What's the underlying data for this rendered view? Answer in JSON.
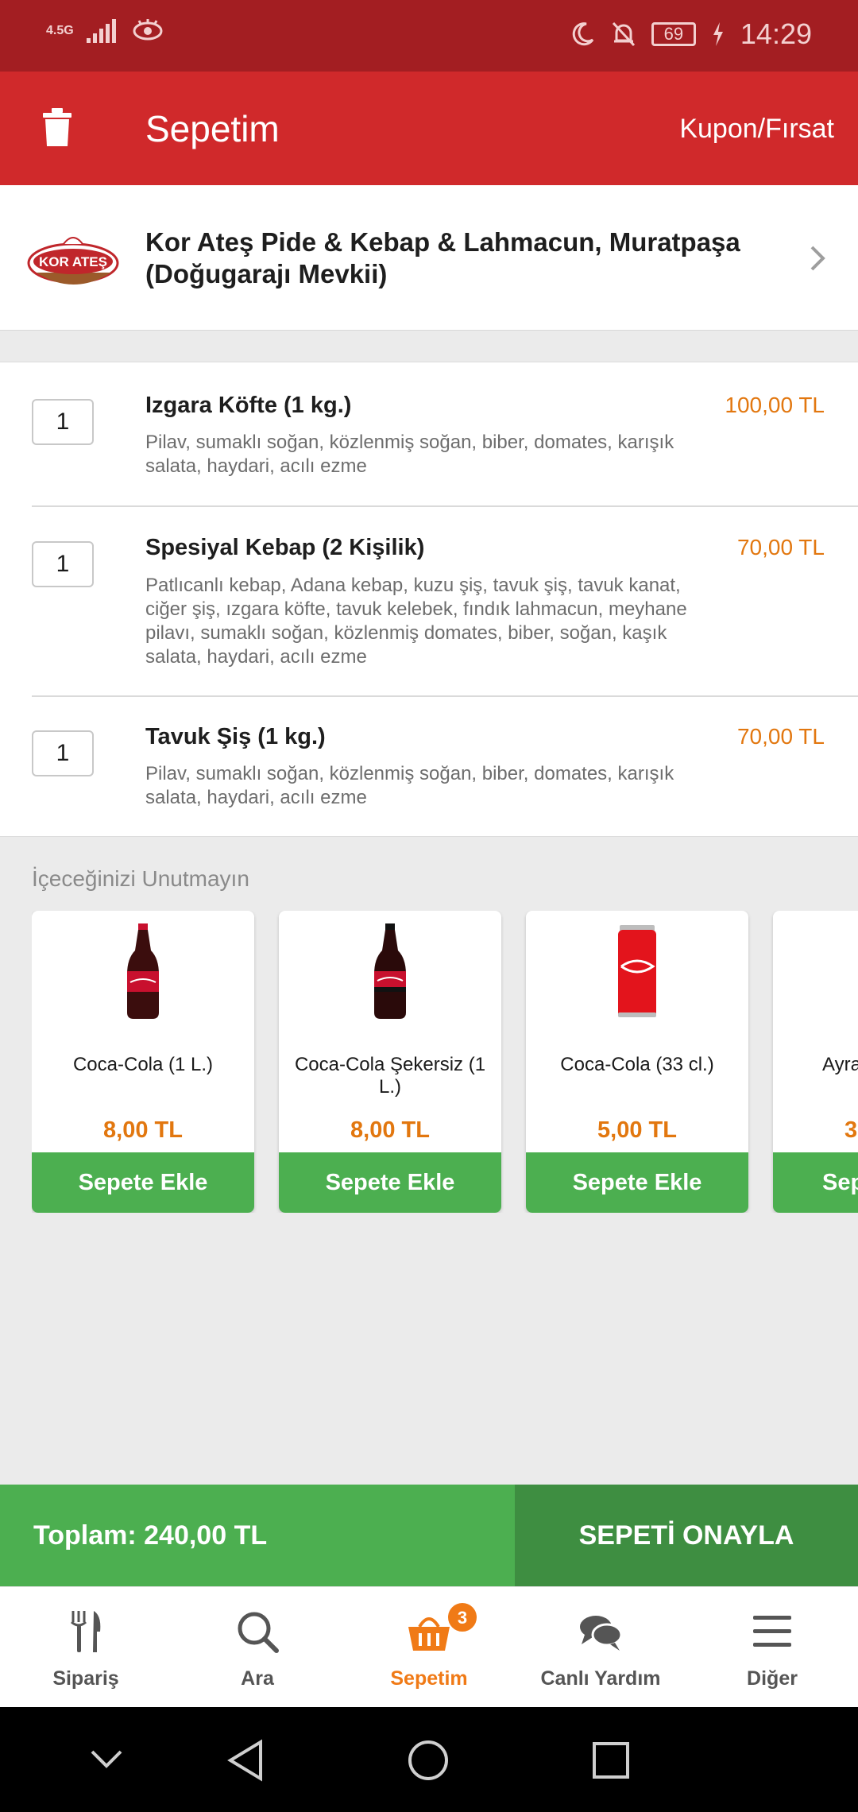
{
  "status_bar": {
    "network": "4.5G",
    "battery": "69",
    "time": "14:29"
  },
  "toolbar": {
    "title": "Sepetim",
    "coupon_label": "Kupon/Fırsat"
  },
  "restaurant": {
    "name": "Kor Ateş Pide & Kebap & Lahmacun, Muratpaşa (Doğugarajı Mevkii)",
    "logo_text": "KOR ATEŞ"
  },
  "cart_items": [
    {
      "qty": "1",
      "name": "Izgara Köfte (1 kg.)",
      "price": "100,00 TL",
      "desc": "Pilav, sumaklı soğan, közlenmiş soğan, biber, domates, karışık salata, haydari, acılı ezme"
    },
    {
      "qty": "1",
      "name": "Spesiyal Kebap (2 Kişilik)",
      "price": "70,00 TL",
      "desc": "Patlıcanlı kebap, Adana kebap, kuzu şiş, tavuk şiş, tavuk kanat, ciğer şiş, ızgara köfte, tavuk kelebek, fındık lahmacun, meyhane pilavı, sumaklı soğan, közlenmiş domates, biber, soğan, kaşık salata, haydari, acılı ezme"
    },
    {
      "qty": "1",
      "name": "Tavuk Şiş (1 kg.)",
      "price": "70,00 TL",
      "desc": "Pilav, sumaklı soğan, közlenmiş soğan, biber, domates, karışık salata, haydari, acılı ezme"
    }
  ],
  "drinks": {
    "title": "İçeceğinizi Unutmayın",
    "add_label": "Sepete Ekle",
    "items": [
      {
        "name": "Coca-Cola (1 L.)",
        "price": "8,00 TL"
      },
      {
        "name": "Coca-Cola Şekersiz (1 L.)",
        "price": "8,00 TL"
      },
      {
        "name": "Coca-Cola (33 cl.)",
        "price": "5,00 TL"
      },
      {
        "name": "Ayra",
        "price": "3"
      }
    ]
  },
  "total": {
    "label": "Toplam: 240,00 TL",
    "confirm_label": "SEPETİ ONAYLA"
  },
  "tabs": [
    {
      "label": "Sipariş",
      "icon": "fork-knife-icon"
    },
    {
      "label": "Ara",
      "icon": "search-icon"
    },
    {
      "label": "Sepetim",
      "icon": "basket-icon",
      "badge": "3",
      "active": true
    },
    {
      "label": "Canlı Yardım",
      "icon": "chat-icon"
    },
    {
      "label": "Diğer",
      "icon": "menu-icon"
    }
  ],
  "colors": {
    "status_bar": "#a31e22",
    "toolbar": "#d0292b",
    "price": "#e2770f",
    "green": "#4caf50",
    "green_dark": "#3e8e41",
    "active_tab": "#f07a16"
  }
}
